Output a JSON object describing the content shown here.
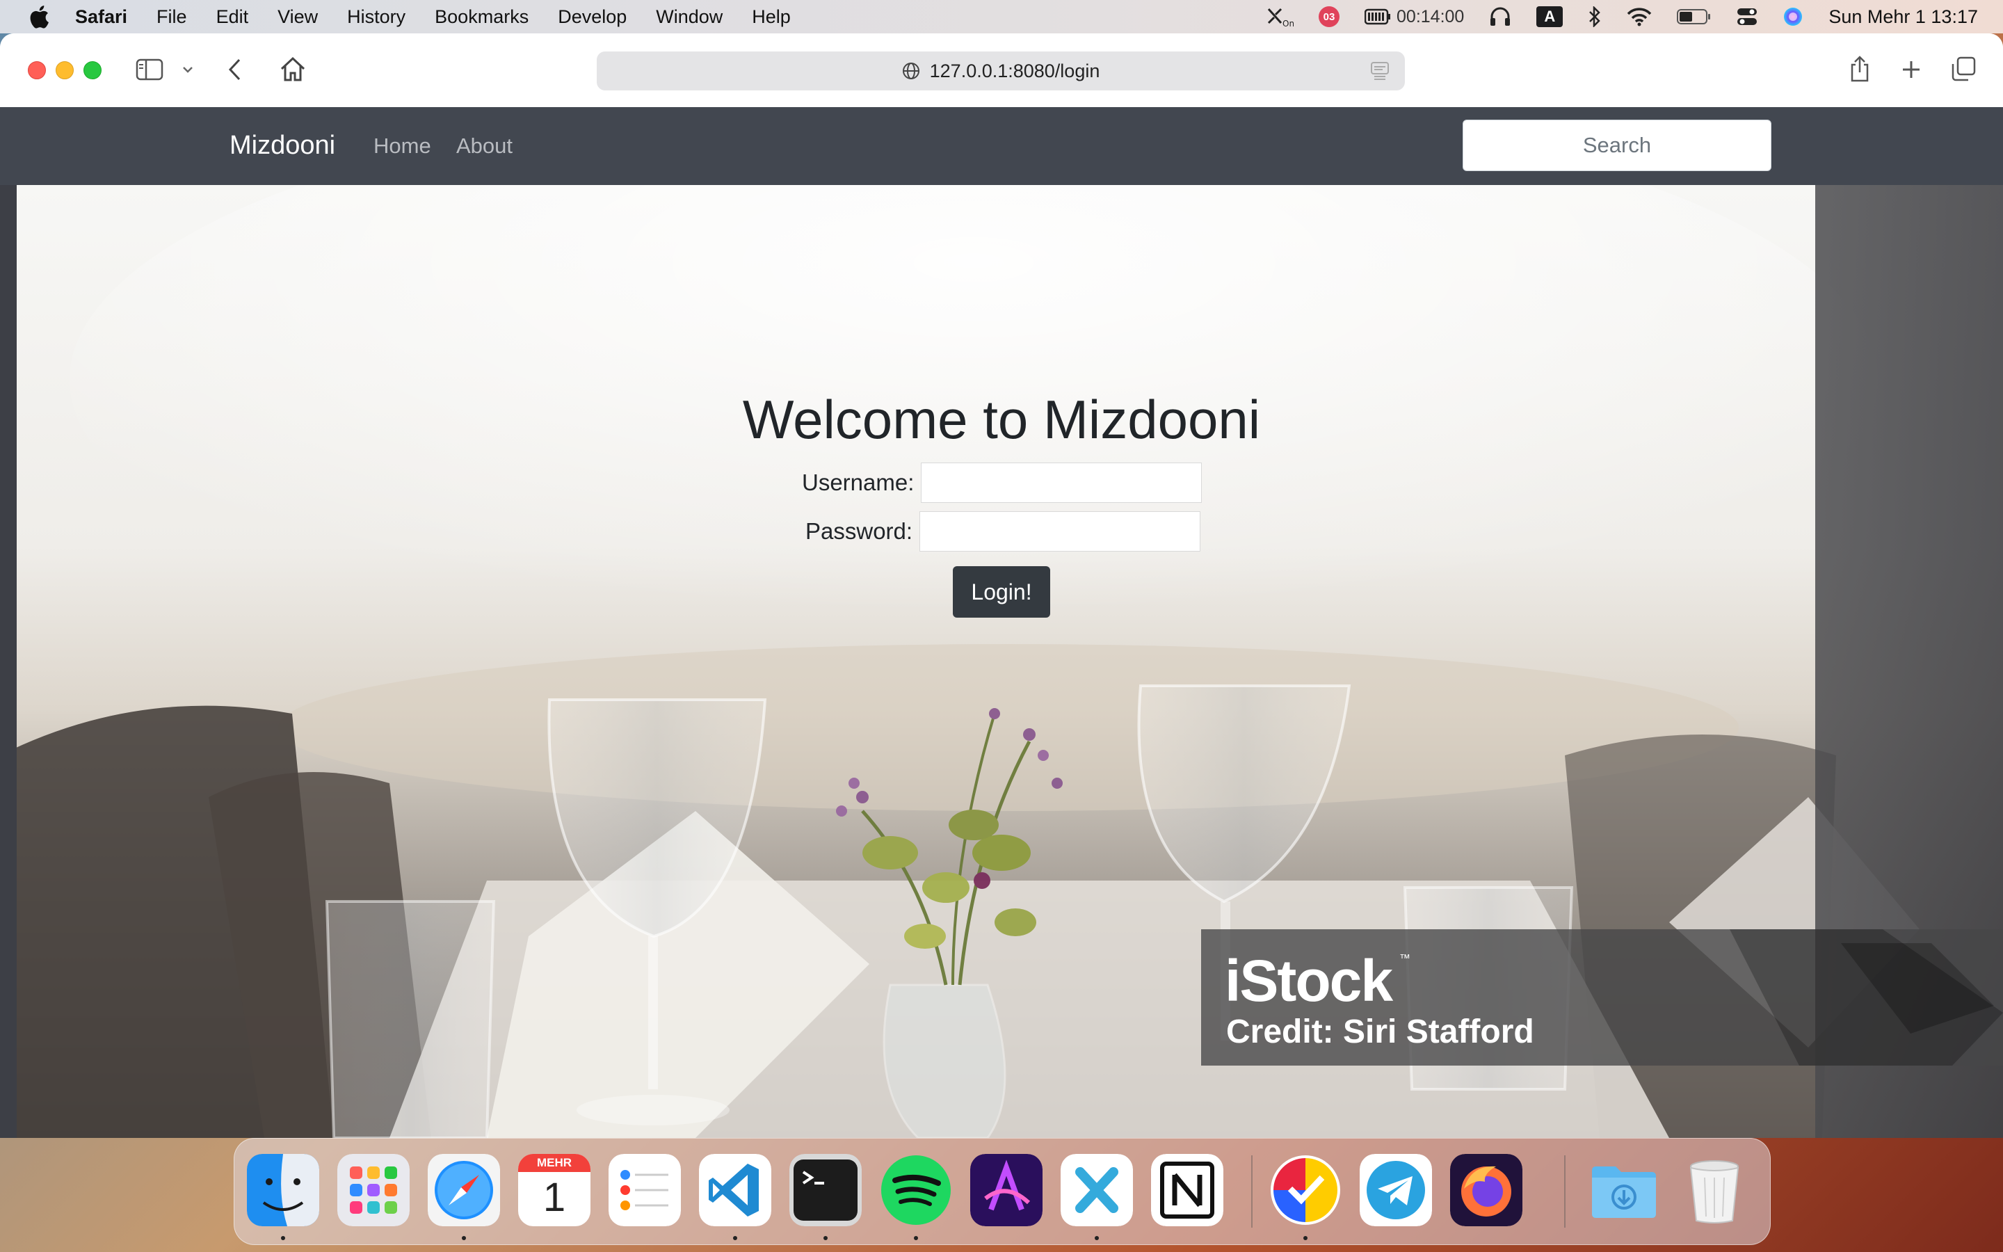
{
  "menubar": {
    "app_name": "Safari",
    "items": [
      "File",
      "Edit",
      "View",
      "History",
      "Bookmarks",
      "Develop",
      "Window",
      "Help"
    ],
    "status": {
      "badge": "03",
      "timer": "00:14:00",
      "input_source": "A",
      "clock": "Sun Mehr 1  13:17"
    }
  },
  "browser": {
    "url": "127.0.0.1:8080/login"
  },
  "site": {
    "brand": "Mizdooni",
    "nav": [
      "Home",
      "About"
    ],
    "search_placeholder": "Search"
  },
  "login": {
    "title": "Welcome to Mizdooni",
    "username_label": "Username:",
    "password_label": "Password:",
    "button": "Login!"
  },
  "watermark": {
    "logo": "iStock",
    "tm": "™",
    "credit": "Credit: Siri Stafford"
  },
  "dock": {
    "calendar_month": "MEHR",
    "calendar_day": "1",
    "items": [
      "Finder",
      "Launchpad",
      "Safari",
      "Calendar",
      "Reminders",
      "Visual Studio Code",
      "Terminal",
      "Spotify",
      "Affinity",
      "Xcode-like",
      "Notion",
      "Tasks",
      "Telegram",
      "Firefox",
      "Downloads",
      "Trash"
    ]
  }
}
